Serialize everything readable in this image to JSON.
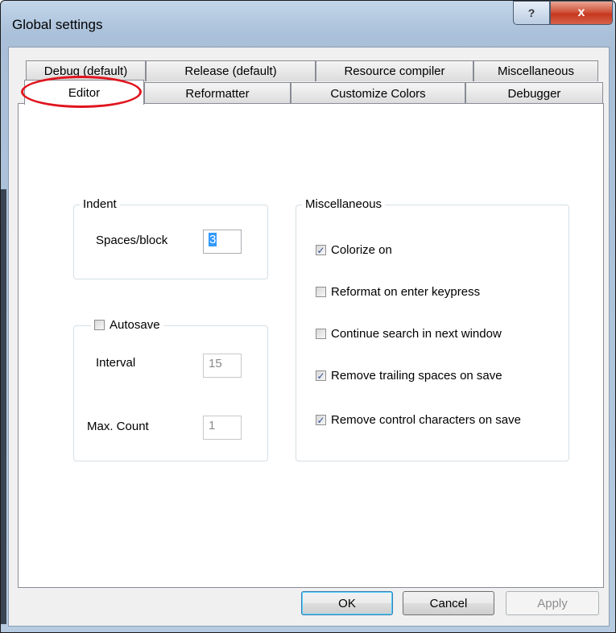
{
  "window": {
    "title": "Global settings",
    "help_glyph": "?",
    "close_glyph": "x"
  },
  "tabs": {
    "back_row": [
      "Debug (default)",
      "Release (default)",
      "Resource compiler",
      "Miscellaneous"
    ],
    "front_row": [
      "Editor",
      "Reformatter",
      "Customize Colors",
      "Debugger"
    ],
    "selected": "Editor"
  },
  "indent": {
    "title": "Indent",
    "spaces_label": "Spaces/block",
    "spaces_value": "3"
  },
  "autosave": {
    "title": "Autosave",
    "checked": false,
    "interval_label": "Interval",
    "interval_value": "15",
    "maxcount_label": "Max. Count",
    "maxcount_value": "1"
  },
  "misc": {
    "title": "Miscellaneous",
    "options": [
      {
        "label": "Colorize on",
        "checked": true
      },
      {
        "label": "Reformat on enter keypress",
        "checked": false
      },
      {
        "label": "Continue search in next window",
        "checked": false
      },
      {
        "label": "Remove trailing spaces on save",
        "checked": true
      },
      {
        "label": "Remove control characters on save",
        "checked": true
      }
    ]
  },
  "buttons": {
    "ok": "OK",
    "cancel": "Cancel",
    "apply": "Apply"
  },
  "colors": {
    "annotation": "#e0141e",
    "checkmark": "#2d4f96",
    "selection": "#3399ff"
  }
}
